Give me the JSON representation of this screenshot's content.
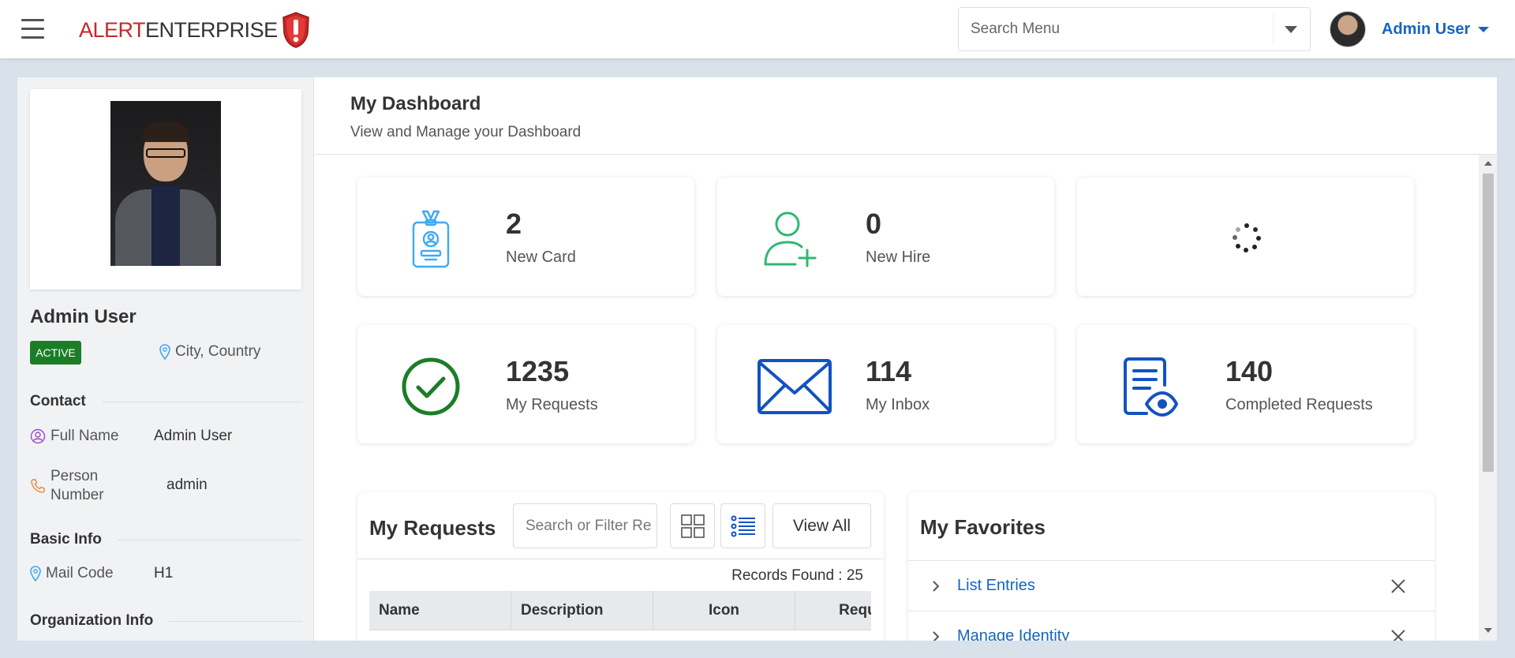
{
  "header": {
    "logo_part1": "ALERT",
    "logo_part2": "ENTERPRISE",
    "search_placeholder": "Search Menu",
    "user_name": "Admin User"
  },
  "profile": {
    "name": "Admin User",
    "status": "ACTIVE",
    "location": "City, Country",
    "contact": {
      "title": "Contact",
      "full_name_label": "Full Name",
      "full_name_value": "Admin User",
      "person_number_label_1": "Person",
      "person_number_label_2": "Number",
      "person_number_value": "admin"
    },
    "basic_info": {
      "title": "Basic Info",
      "mail_code_label": "Mail Code",
      "mail_code_value": "H1"
    },
    "org_info": {
      "title": "Organization Info"
    }
  },
  "dashboard": {
    "title": "My Dashboard",
    "subtitle": "View and Manage your Dashboard",
    "cards": [
      {
        "value": "2",
        "label": "New Card",
        "icon": "id-badge-icon"
      },
      {
        "value": "0",
        "label": "New Hire",
        "icon": "user-plus-icon"
      },
      {
        "value": "",
        "label": "",
        "icon": "loading-spinner-icon"
      },
      {
        "value": "1235",
        "label": "My Requests",
        "icon": "check-circle-icon"
      },
      {
        "value": "114",
        "label": "My Inbox",
        "icon": "envelope-icon"
      },
      {
        "value": "140",
        "label": "Completed Requests",
        "icon": "document-eye-icon"
      }
    ],
    "colors": {
      "badge_icon": "#3fa9f5",
      "user_plus_icon": "#2eb872",
      "check_icon": "#1b7e27",
      "blue_icon": "#1352c2",
      "link": "#1565c0",
      "status_green": "#1b7e27"
    }
  },
  "requests": {
    "title": "My Requests",
    "filter_placeholder": "Search or Filter Re",
    "view_all": "View All",
    "records_found": "Records Found : 25",
    "columns": [
      "Name",
      "Description",
      "Icon",
      "Reques"
    ]
  },
  "favorites": {
    "title": "My Favorites",
    "items": [
      "List Entries",
      "Manage Identity"
    ]
  }
}
